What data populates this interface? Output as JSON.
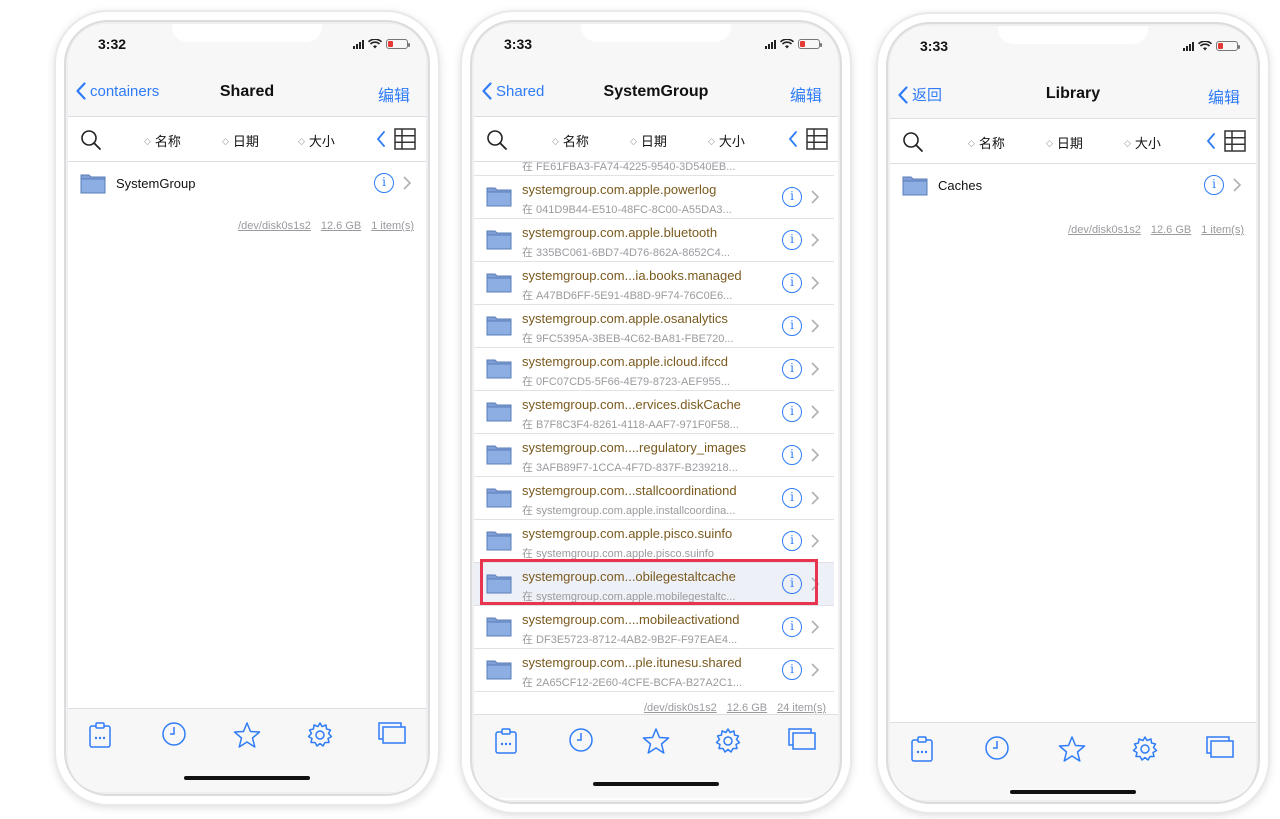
{
  "colors": {
    "accent": "#2f7cf6",
    "folder_blue": "#7f9fd6",
    "highlight_red": "#e8344e",
    "battery_low": "#e53935"
  },
  "sort": {
    "name": "名称",
    "date": "日期",
    "size": "大小"
  },
  "phones": [
    {
      "time": "3:32",
      "back_label": "containers",
      "title": "Shared",
      "edit_label": "编辑",
      "file": {
        "name": "SystemGroup"
      },
      "footer": {
        "device": "/dev/disk0s1s2",
        "size": "12.6 GB",
        "count": "1 item(s)"
      }
    },
    {
      "time": "3:33",
      "back_label": "Shared",
      "title": "SystemGroup",
      "edit_label": "编辑",
      "partial_row_sub": "在 FE61FBA3-FA74-4225-9540-3D540EB...",
      "items": [
        {
          "name": "systemgroup.com.apple.powerlog",
          "sub": "在 041D9B44-E510-48FC-8C00-A55DA3..."
        },
        {
          "name": "systemgroup.com.apple.bluetooth",
          "sub": "在 335BC061-6BD7-4D76-862A-8652C4..."
        },
        {
          "name": "systemgroup.com...ia.books.managed",
          "sub": "在 A47BD6FF-5E91-4B8D-9F74-76C0E6..."
        },
        {
          "name": "systemgroup.com.apple.osanalytics",
          "sub": "在 9FC5395A-3BEB-4C62-BA81-FBE720..."
        },
        {
          "name": "systemgroup.com.apple.icloud.ifccd",
          "sub": "在 0FC07CD5-5F66-4E79-8723-AEF955..."
        },
        {
          "name": "systemgroup.com...ervices.diskCache",
          "sub": "在 B7F8C3F4-8261-4118-AAF7-971F0F58..."
        },
        {
          "name": "systemgroup.com....regulatory_images",
          "sub": "在 3AFB89F7-1CCA-4F7D-837F-B239218..."
        },
        {
          "name": "systemgroup.com...stallcoordinationd",
          "sub": "在 systemgroup.com.apple.installcoordina..."
        },
        {
          "name": "systemgroup.com.apple.pisco.suinfo",
          "sub": "在 systemgroup.com.apple.pisco.suinfo"
        },
        {
          "name": "systemgroup.com...obilegestaltcache",
          "sub": "在 systemgroup.com.apple.mobilegestaltc..."
        },
        {
          "name": "systemgroup.com....mobileactivationd",
          "sub": "在 DF3E5723-8712-4AB2-9B2F-F97EAE4..."
        },
        {
          "name": "systemgroup.com...ple.itunesu.shared",
          "sub": "在 2A65CF12-2E60-4CFE-BCFA-B27A2C1..."
        }
      ],
      "footer": {
        "device": "/dev/disk0s1s2",
        "size": "12.6 GB",
        "count": "24 item(s)"
      }
    },
    {
      "time": "3:33",
      "back_label": "返回",
      "title": "Library",
      "edit_label": "编辑",
      "file": {
        "name": "Caches"
      },
      "footer": {
        "device": "/dev/disk0s1s2",
        "size": "12.6 GB",
        "count": "1 item(s)"
      }
    }
  ]
}
